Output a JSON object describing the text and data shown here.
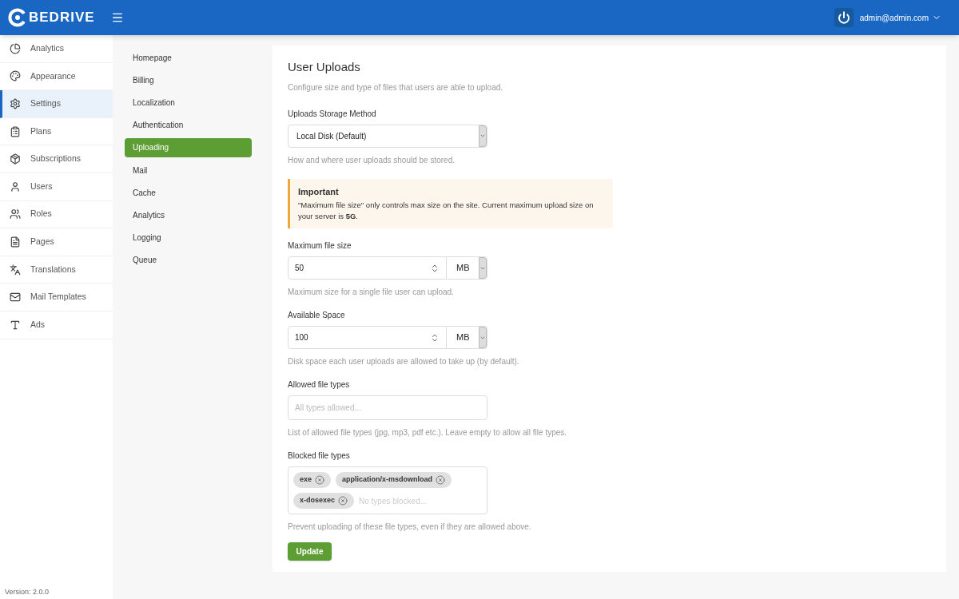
{
  "header": {
    "logo": "BEDRIVE",
    "user": "admin@admin.com"
  },
  "sidebar": {
    "items": [
      {
        "label": "Analytics",
        "selected": false
      },
      {
        "label": "Appearance",
        "selected": false
      },
      {
        "label": "Settings",
        "selected": true
      },
      {
        "label": "Plans",
        "selected": false
      },
      {
        "label": "Subscriptions",
        "selected": false
      },
      {
        "label": "Users",
        "selected": false
      },
      {
        "label": "Roles",
        "selected": false
      },
      {
        "label": "Pages",
        "selected": false
      },
      {
        "label": "Translations",
        "selected": false
      },
      {
        "label": "Mail Templates",
        "selected": false
      },
      {
        "label": "Ads",
        "selected": false
      }
    ],
    "version": "Version: 2.0.0"
  },
  "settings_nav": [
    {
      "label": "Homepage",
      "selected": false
    },
    {
      "label": "Billing",
      "selected": false
    },
    {
      "label": "Localization",
      "selected": false
    },
    {
      "label": "Authentication",
      "selected": false
    },
    {
      "label": "Uploading",
      "selected": true
    },
    {
      "label": "Mail",
      "selected": false
    },
    {
      "label": "Cache",
      "selected": false
    },
    {
      "label": "Analytics",
      "selected": false
    },
    {
      "label": "Logging",
      "selected": false
    },
    {
      "label": "Queue",
      "selected": false
    }
  ],
  "panel": {
    "title": "User Uploads",
    "subtitle": "Configure size and type of files that users are able to upload.",
    "storage": {
      "label": "Uploads Storage Method",
      "value": "Local Disk (Default)",
      "hint": "How and where user uploads should be stored."
    },
    "notice": {
      "title": "Important",
      "text": "\"Maximum file size\" only controls max size on the site. Current maximum upload size on your server is **5G**."
    },
    "max_size": {
      "label": "Maximum file size",
      "value": "50",
      "unit": "MB",
      "hint": "Maximum size for a single file user can upload."
    },
    "space": {
      "label": "Available Space",
      "value": "100",
      "unit": "MB",
      "hint": "Disk space each user uploads are allowed to take up (by default)."
    },
    "allowed": {
      "label": "Allowed file types",
      "placeholder": "All types allowed...",
      "hint": "List of allowed file types (jpg, mp3, pdf etc.). Leave empty to allow all file types."
    },
    "blocked": {
      "label": "Blocked file types",
      "chips": [
        "exe",
        "application/x-msdownload",
        "x-dosexec"
      ],
      "placeholder": "No types blocked...",
      "hint": "Prevent uploading of these file types, even if they are allowed above."
    },
    "button": "Update"
  }
}
